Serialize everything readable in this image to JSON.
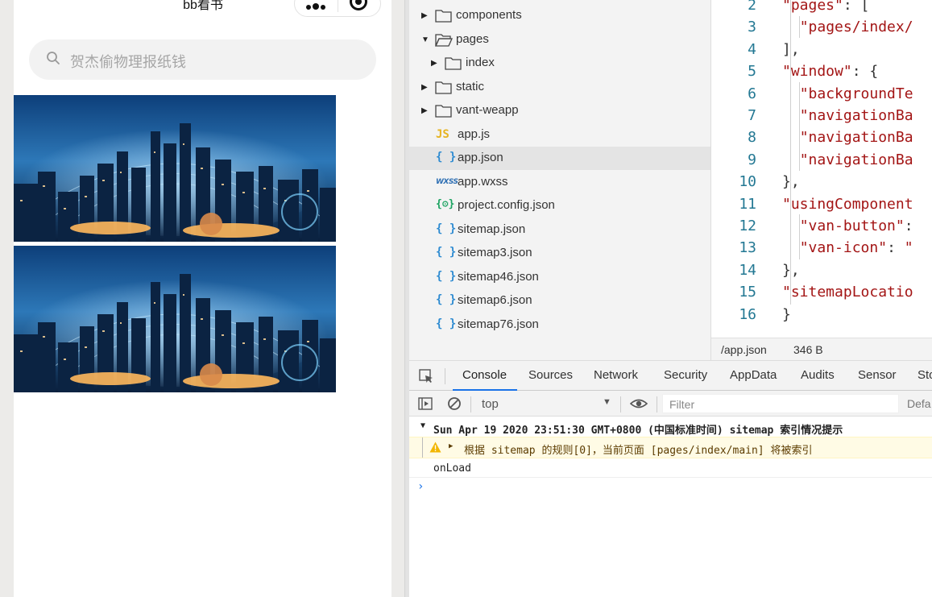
{
  "simulator": {
    "title": "bb看书",
    "search_placeholder": "贺杰偷物理报纸钱",
    "banners": [
      "city-night-banner",
      "city-night-banner"
    ]
  },
  "file_tree": {
    "items": [
      {
        "label": "components",
        "type": "folder",
        "expanded": false,
        "depth": 0
      },
      {
        "label": "pages",
        "type": "folder",
        "expanded": true,
        "depth": 0
      },
      {
        "label": "index",
        "type": "folder",
        "expanded": false,
        "depth": 1
      },
      {
        "label": "static",
        "type": "folder",
        "expanded": false,
        "depth": 0
      },
      {
        "label": "vant-weapp",
        "type": "folder",
        "expanded": false,
        "depth": 0
      },
      {
        "label": "app.js",
        "type": "js",
        "depth": 0
      },
      {
        "label": "app.json",
        "type": "json",
        "depth": 0,
        "selected": true
      },
      {
        "label": "app.wxss",
        "type": "wxss",
        "depth": 0
      },
      {
        "label": "project.config.json",
        "type": "config",
        "depth": 0
      },
      {
        "label": "sitemap.json",
        "type": "json",
        "depth": 0
      },
      {
        "label": "sitemap3.json",
        "type": "json",
        "depth": 0
      },
      {
        "label": "sitemap46.json",
        "type": "json",
        "depth": 0
      },
      {
        "label": "sitemap6.json",
        "type": "json",
        "depth": 0
      },
      {
        "label": "sitemap76.json",
        "type": "json",
        "depth": 0
      }
    ]
  },
  "editor": {
    "lines": [
      {
        "num": "2",
        "code": "\"pages\": ["
      },
      {
        "num": "3",
        "code": "  \"pages/index/"
      },
      {
        "num": "4",
        "code": "],"
      },
      {
        "num": "5",
        "code": "\"window\": {"
      },
      {
        "num": "6",
        "code": "  \"backgroundTe"
      },
      {
        "num": "7",
        "code": "  \"navigationBa"
      },
      {
        "num": "8",
        "code": "  \"navigationBa"
      },
      {
        "num": "9",
        "code": "  \"navigationBa"
      },
      {
        "num": "10",
        "code": "},"
      },
      {
        "num": "11",
        "code": "\"usingComponent"
      },
      {
        "num": "12",
        "code": "  \"van-button\":"
      },
      {
        "num": "13",
        "code": "  \"van-icon\": \""
      },
      {
        "num": "14",
        "code": "},"
      },
      {
        "num": "15",
        "code": "\"sitemapLocatio"
      },
      {
        "num": "16",
        "code": "}"
      }
    ],
    "status_path": "/app.json",
    "status_size": "346 B"
  },
  "devtools": {
    "tabs": [
      "Console",
      "Sources",
      "Network",
      "Security",
      "AppData",
      "Audits",
      "Sensor",
      "Sto"
    ],
    "active_tab": "Console",
    "context": "top",
    "filter_placeholder": "Filter",
    "default_levels": "Defa",
    "console": {
      "group_header": "Sun Apr 19 2020 23:51:30 GMT+0800 (中国标准时间) sitemap 索引情况提示",
      "warning": "根据 sitemap 的规则[0]，当前页面 [pages/index/main] 将被索引",
      "log": "onLoad"
    }
  },
  "colors": {
    "accent": "#1a73e8",
    "line_number": "#237893",
    "string": "#a31515",
    "warning_bg": "#fffbe5"
  }
}
